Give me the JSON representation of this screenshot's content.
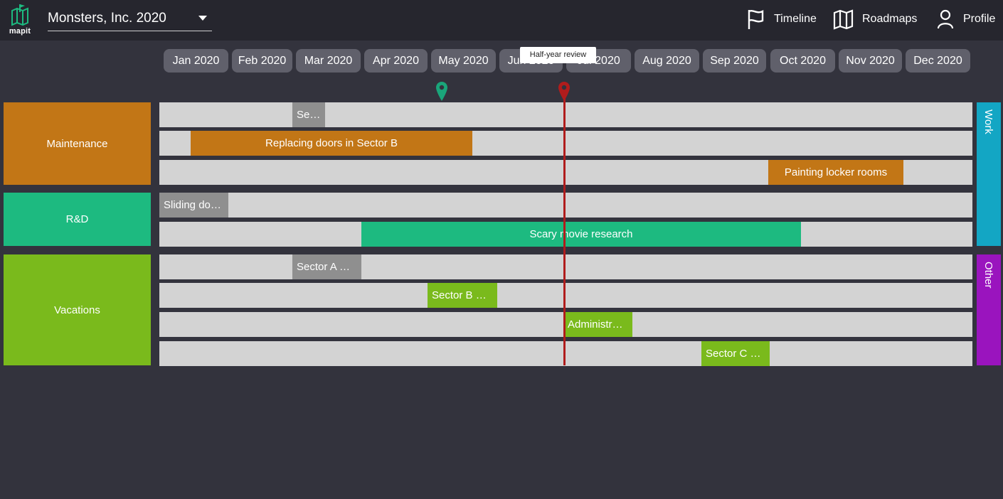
{
  "app": {
    "logo_text": "mapit",
    "project": "Monsters, Inc. 2020"
  },
  "nav": {
    "timeline": "Timeline",
    "roadmaps": "Roadmaps",
    "profile": "Profile"
  },
  "months": [
    "Jan 2020",
    "Feb 2020",
    "Mar 2020",
    "Apr 2020",
    "May 2020",
    "Jun 2020",
    "Jul 2020",
    "Aug 2020",
    "Sep 2020",
    "Oct 2020",
    "Nov 2020",
    "Dec 2020"
  ],
  "milestones": [
    {
      "label": "Half-year review",
      "color": "#b01c1c"
    },
    {
      "label": "",
      "color": "#1aa57a"
    }
  ],
  "groups": {
    "maintenance": "Maintenance",
    "rnd": "R&D",
    "vacations": "Vacations"
  },
  "categories": {
    "work": "Work",
    "other": "Other"
  },
  "tasks": {
    "t1": "Se…",
    "t2": "Replacing doors in Sector B",
    "t3": "Painting locker rooms",
    "t4": "Sliding do…",
    "t5": "Scary movie research",
    "t6": "Sector A …",
    "t7": "Sector B …",
    "t8": "Administr…",
    "t9": "Sector C …"
  },
  "colors": {
    "maintenance": "#c27616",
    "rnd": "#1dba80",
    "vacations": "#7aba1c",
    "pending": "#8f8f8f",
    "work": "#13a6c4",
    "other": "#9a14be",
    "today": "#b01c1c"
  }
}
